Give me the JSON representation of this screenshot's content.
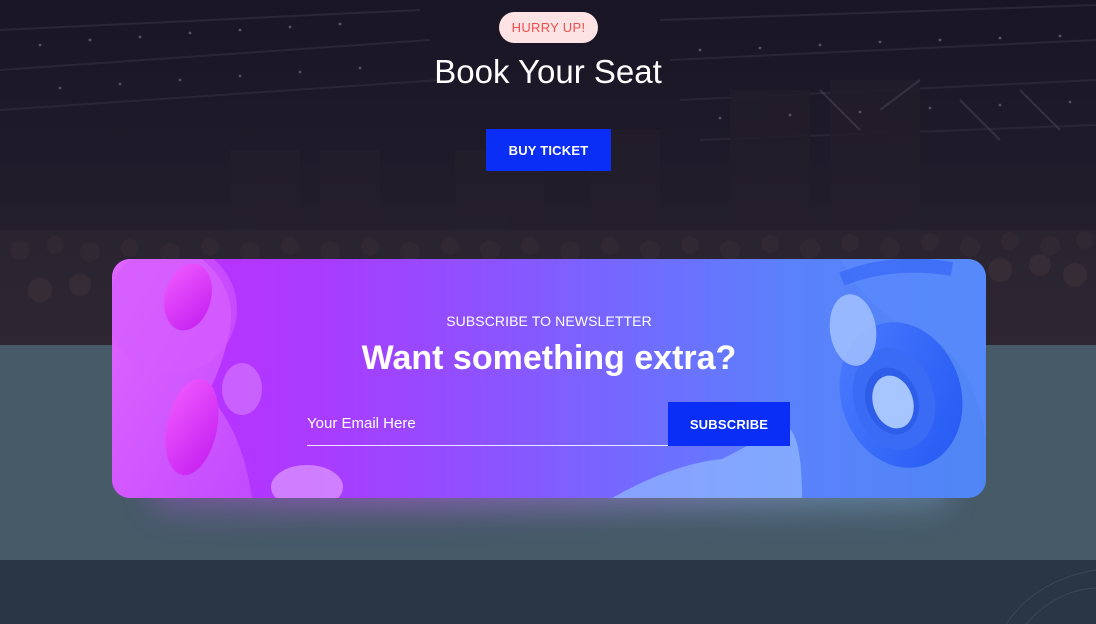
{
  "hero": {
    "badge": "HURRY UP!",
    "title": "Book Your Seat",
    "buy_button": "BUY TICKET"
  },
  "newsletter": {
    "eyebrow": "SUBSCRIBE TO NEWSLETTER",
    "title": "Want something extra?",
    "email_placeholder": "Your Email Here",
    "email_value": "",
    "subscribe_button": "SUBSCRIBE"
  },
  "colors": {
    "accent_blue": "#0a2ef5",
    "badge_bg": "#fde3e3",
    "badge_text": "#ef4e4e",
    "card_gradient_start": "#c52bff",
    "card_gradient_end": "#4f86f5",
    "band": "#465a68",
    "footer": "#283645"
  },
  "icons": {
    "hero_background": "conference-hall-photo",
    "card_left_decoration": "abstract-speaker-shapes",
    "card_right_decoration": "headphones-illustration"
  }
}
